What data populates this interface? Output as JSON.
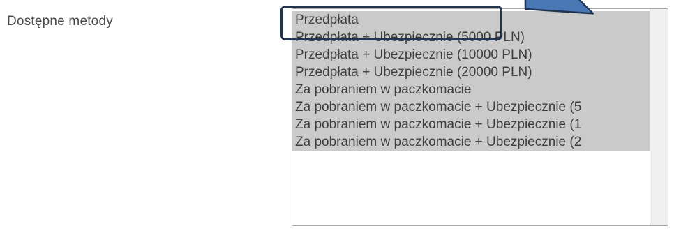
{
  "form": {
    "label": "Dostępne metody",
    "options": [
      "Przedpłata",
      "Przedpłata + Ubezpiecznie (5000 PLN)",
      "Przedpłata + Ubezpiecznie (10000 PLN)",
      "Przedpłata + Ubezpiecznie (20000 PLN)",
      "Za pobraniem w paczkomacie",
      "Za pobraniem w paczkomacie + Ubezpiecznie (5",
      "Za pobraniem w paczkomacie + Ubezpiecznie (1",
      "Za pobraniem w paczkomacie + Ubezpiecznie (2"
    ]
  },
  "annotation": {
    "highlight_color": "#1f3552",
    "arrow_fill": "#4a78b5",
    "arrow_stroke": "#1f3552",
    "points_to": "option-0"
  },
  "colors": {
    "selected_option_bg": "#cacaca",
    "option_text": "#3e3e3e",
    "label_text": "#4a4a4a"
  }
}
